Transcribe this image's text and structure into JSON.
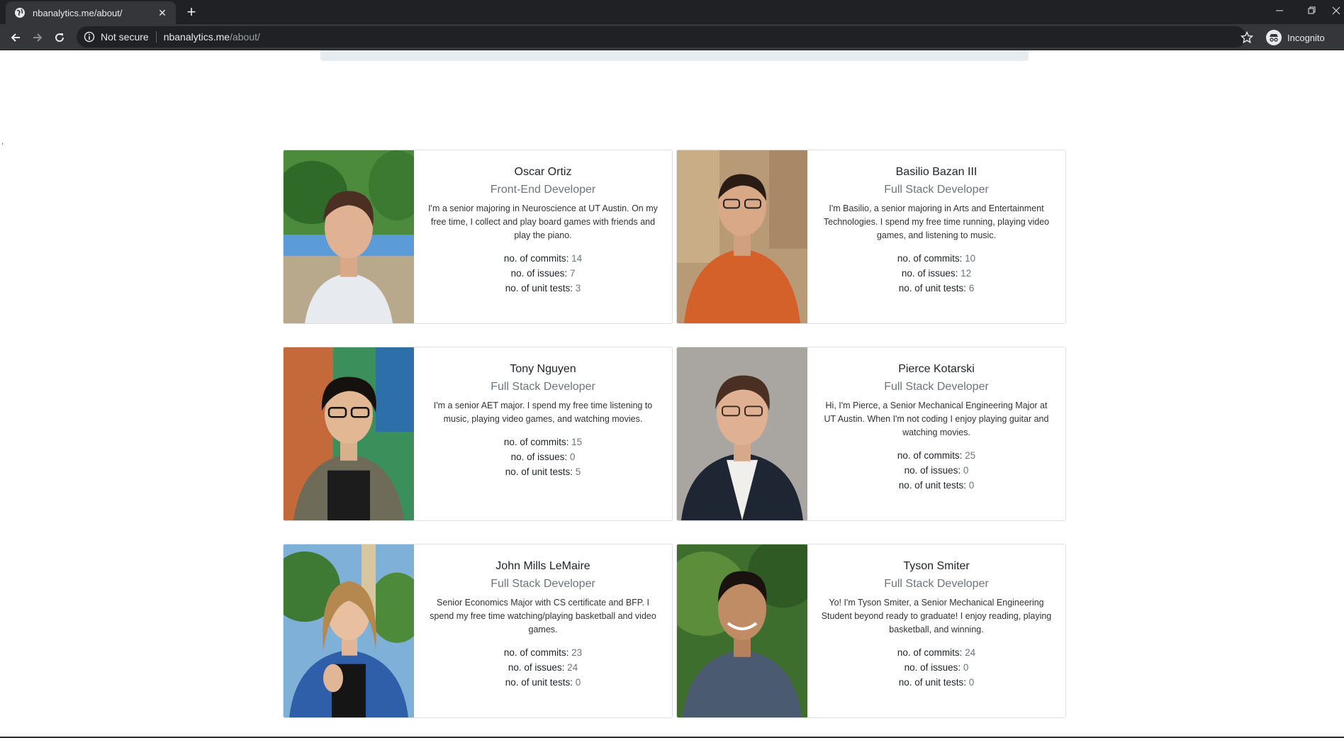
{
  "browser": {
    "tab_title": "nbanalytics.me/about/",
    "security_label": "Not secure",
    "url_host": "nbanalytics.me",
    "url_path": "/about/",
    "incognito_label": "Incognito"
  },
  "page": {
    "stray_char": ","
  },
  "stat_labels": {
    "commits": "no. of commits:",
    "issues": "no. of issues:",
    "tests": "no. of unit tests:"
  },
  "members": [
    {
      "name": "Oscar Ortiz",
      "role": "Front-End Developer",
      "bio": "I'm a senior majoring in Neuroscience at UT Austin. On my free time, I collect and play board games with friends and play the piano.",
      "commits": "14",
      "issues": "7",
      "tests": "3"
    },
    {
      "name": "Basilio Bazan III",
      "role": "Full Stack Developer",
      "bio": "I'm Basilio, a senior majoring in Arts and Entertainment Technologies. I spend my free time running, playing video games, and listening to music.",
      "commits": "10",
      "issues": "12",
      "tests": "6"
    },
    {
      "name": "Tony Nguyen",
      "role": "Full Stack Developer",
      "bio": "I'm a senior AET major. I spend my free time listening to music, playing video games, and watching movies.",
      "commits": "15",
      "issues": "0",
      "tests": "5"
    },
    {
      "name": "Pierce Kotarski",
      "role": "Full Stack Developer",
      "bio": "Hi, I'm Pierce, a Senior Mechanical Engineering Major at UT Austin. When I'm not coding I enjoy playing guitar and watching movies.",
      "commits": "25",
      "issues": "0",
      "tests": "0"
    },
    {
      "name": "John Mills LeMaire",
      "role": "Full Stack Developer",
      "bio": "Senior Economics Major with CS certificate and BFP. I spend my free time watching/playing basketball and video games.",
      "commits": "23",
      "issues": "24",
      "tests": "0"
    },
    {
      "name": "Tyson Smiter",
      "role": "Full Stack Developer",
      "bio": "Yo! I'm Tyson Smiter, a Senior Mechanical Engineering Student beyond ready to graduate! I enjoy reading, playing basketball, and winning.",
      "commits": "24",
      "issues": "0",
      "tests": "0"
    }
  ]
}
